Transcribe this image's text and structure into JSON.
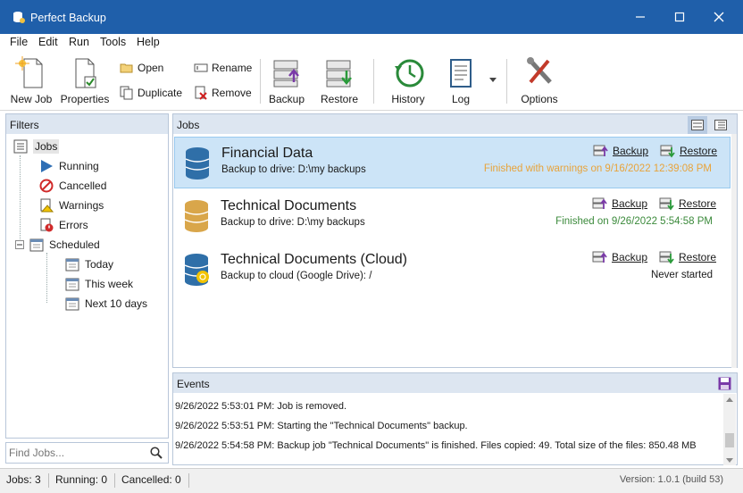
{
  "window": {
    "title": "Perfect Backup"
  },
  "menu": [
    "File",
    "Edit",
    "Run",
    "Tools",
    "Help"
  ],
  "toolbar": {
    "new_job": "New Job",
    "properties": "Properties",
    "open": "Open",
    "duplicate": "Duplicate",
    "rename": "Rename",
    "remove": "Remove",
    "backup": "Backup",
    "restore": "Restore",
    "history": "History",
    "log": "Log",
    "options": "Options"
  },
  "filters": {
    "header": "Filters",
    "items": [
      "Jobs",
      "Running",
      "Cancelled",
      "Warnings",
      "Errors",
      "Scheduled",
      "Today",
      "This week",
      "Next 10 days"
    ]
  },
  "search": {
    "placeholder": "Find Jobs..."
  },
  "jobs": {
    "header": "Jobs",
    "backup_label": "Backup",
    "restore_label": "Restore",
    "list": [
      {
        "name": "Financial Data",
        "desc": "Backup to drive: D:\\my backups",
        "status": "Finished with warnings on 9/16/2022 12:39:08 PM",
        "status_color": "#e8a33a",
        "icon_color": "#2f6fa8"
      },
      {
        "name": "Technical Documents",
        "desc": "Backup to drive: D:\\my backups",
        "status": "Finished on 9/26/2022 5:54:58 PM",
        "status_color": "#3b8a3b",
        "icon_color": "#d9a64a"
      },
      {
        "name": "Technical Documents (Cloud)",
        "desc": "Backup to cloud (Google Drive): /",
        "status": "Never started",
        "status_color": "#1a1a1a",
        "icon_color": "#2f6fa8"
      }
    ]
  },
  "events": {
    "header": "Events",
    "lines": [
      "9/26/2022 5:53:01 PM: Job is removed.",
      "9/26/2022 5:53:51 PM: Starting the \"Technical Documents\" backup.",
      "9/26/2022 5:54:58 PM: Backup job \"Technical Documents\" is finished. Files copied: 49. Total size of the files: 850.48 MB"
    ]
  },
  "statusbar": {
    "jobs": "Jobs: 3",
    "running": "Running: 0",
    "cancelled": "Cancelled: 0",
    "version": "Version: 1.0.1 (build 53)"
  },
  "colors": {
    "titlebar": "#1f5faa",
    "selection": "#cce4f7",
    "panel_header": "#dde6f1"
  }
}
